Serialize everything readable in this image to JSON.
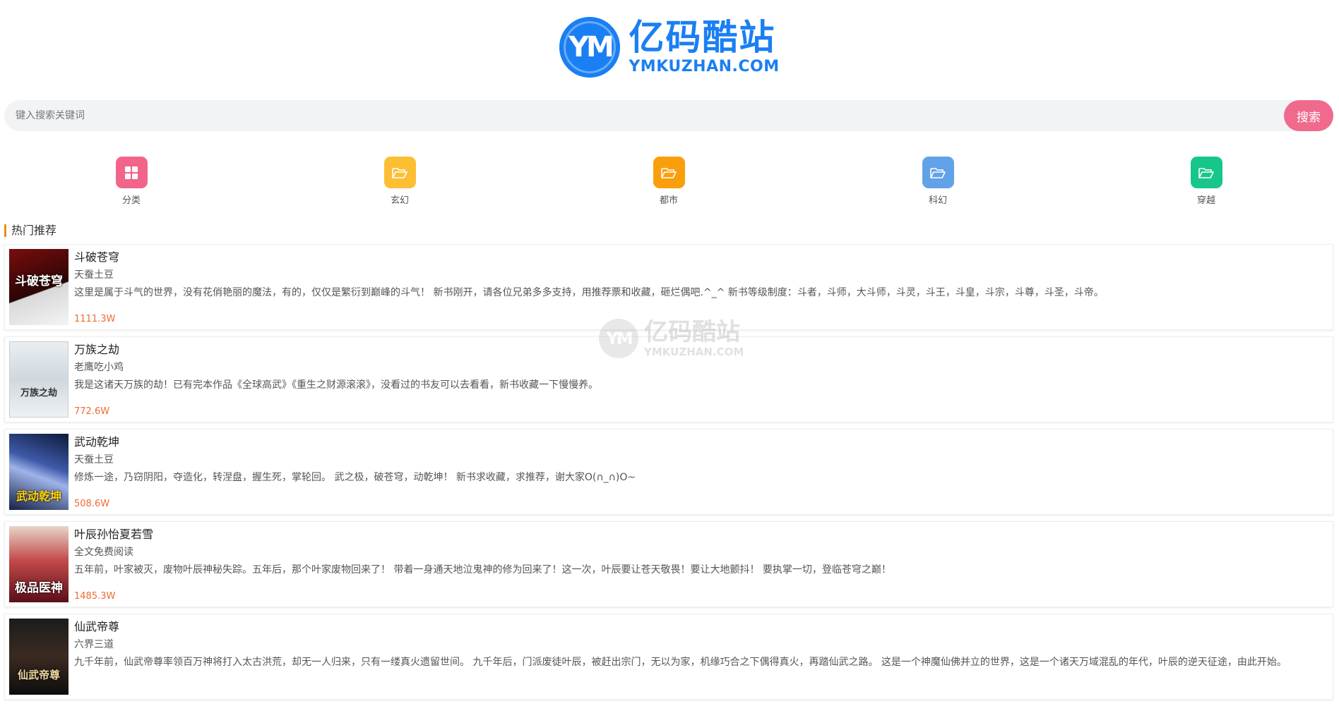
{
  "logo": {
    "mark": "YM",
    "name_cn": "亿码酷站",
    "name_en": "YMKUZHAN.COM"
  },
  "search": {
    "placeholder": "键入搜索关键词",
    "value": "",
    "button_label": "搜索"
  },
  "categories": [
    {
      "label": "分类",
      "icon": "grid-icon",
      "color": "#f2658a"
    },
    {
      "label": "玄幻",
      "icon": "folder-open-icon",
      "color": "#fcbf33"
    },
    {
      "label": "都市",
      "icon": "folder-open-icon",
      "color": "#fa9f0c"
    },
    {
      "label": "科幻",
      "icon": "folder-open-icon",
      "color": "#62a2e8"
    },
    {
      "label": "穿越",
      "icon": "folder-open-icon",
      "color": "#17c78a"
    }
  ],
  "section": {
    "title": "热门推荐",
    "accent": "#f08a1c"
  },
  "books": [
    {
      "title": "斗破苍穹",
      "author": "天蚕土豆",
      "description": "这里是属于斗气的世界，没有花俏艳丽的魔法，有的，仅仅是繁衍到巅峰的斗气！ 新书刚开，请各位兄弟多多支持，用推荐票和收藏，砸烂偶吧.^_^ 新书等级制度：斗者，斗师，大斗师，斗灵，斗王，斗皇，斗宗，斗尊，斗圣，斗帝。",
      "count": "1111.3W",
      "cover_title": "斗破苍穹"
    },
    {
      "title": "万族之劫",
      "author": "老鹰吃小鸡",
      "description": "我是这诸天万族的劫！已有完本作品《全球高武》《重生之财源滚滚》，没看过的书友可以去看看，新书收藏一下慢慢养。",
      "count": "772.6W",
      "cover_title": "万族之劫"
    },
    {
      "title": "武动乾坤",
      "author": "天蚕土豆",
      "description": "修炼一途，乃窃阴阳，夺造化，转涅盘，握生死，掌轮回。 武之极，破苍穹，动乾坤！ 新书求收藏，求推荐，谢大家O(∩_∩)O~",
      "count": "508.6W",
      "cover_title": "武动乾坤"
    },
    {
      "title": "叶辰孙怡夏若雪",
      "author": "全文免费阅读",
      "description": "五年前，叶家被灭，废物叶辰神秘失踪。五年后，那个叶家废物回来了！ 带着一身通天地泣鬼神的修为回来了！这一次，叶辰要让苍天敬畏！要让大地颤抖！ 要执掌一切，登临苍穹之巅！",
      "count": "1485.3W",
      "cover_title": "极品医神"
    },
    {
      "title": "仙武帝尊",
      "author": "六界三道",
      "description": "九千年前，仙武帝尊率领百万神将打入太古洪荒，却无一人归来，只有一缕真火遗留世间。 九千年后，门派废徒叶辰，被赶出宗门，无以为家，机缘巧合之下偶得真火，再踏仙武之路。 这是一个神魔仙佛并立的世界，这是一个诸天万域混乱的年代，叶辰的逆天征途，由此开始。",
      "count": "",
      "cover_title": "仙武帝尊"
    }
  ],
  "watermark": {
    "mark": "YM",
    "name_cn": "亿码酷站",
    "name_en": "YMKUZHAN.COM"
  },
  "colors": {
    "brand": "#1a7ff2",
    "search_button": "#f06a8e",
    "count": "#f06b33"
  }
}
